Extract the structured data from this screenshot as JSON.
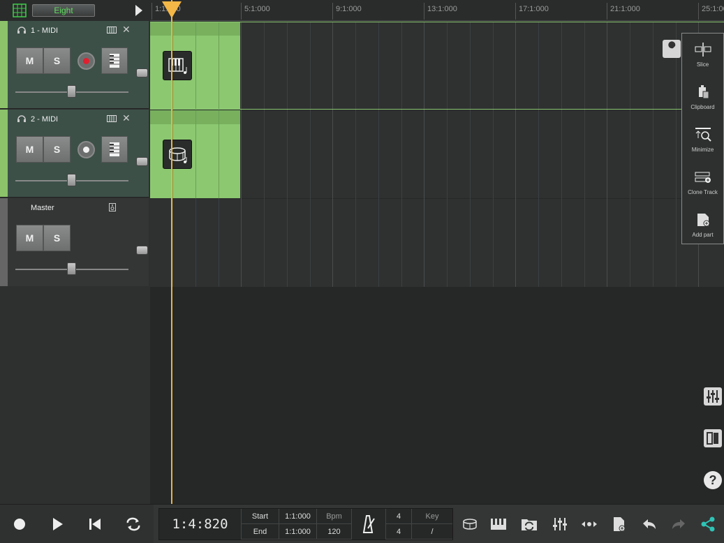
{
  "header": {
    "snap_value": "Eight"
  },
  "ruler": {
    "marks": [
      "1:1:000",
      "5:1:000",
      "9:1:000",
      "13:1:000",
      "17:1:000",
      "21:1:000",
      "25:1:000"
    ]
  },
  "tracks": [
    {
      "name": "1 - MIDI",
      "mute": "M",
      "solo": "S",
      "record_armed": true,
      "volume": 0.5
    },
    {
      "name": "2 - MIDI",
      "mute": "M",
      "solo": "S",
      "record_armed": false,
      "volume": 0.5
    }
  ],
  "master": {
    "name": "Master",
    "mute": "M",
    "solo": "S",
    "volume": 0.5
  },
  "tools": {
    "slice": "Slice",
    "clipboard": "Clipboard",
    "minimize": "Minimize",
    "clone_track": "Clone Track",
    "add_part": "Add part"
  },
  "transport": {
    "position": "1:4:820",
    "start_label": "Start",
    "start_value": "1:1:000",
    "end_label": "End",
    "end_value": "1:1:000",
    "bpm_label": "Bpm",
    "bpm_value": "120",
    "time_sig_top": "4",
    "time_sig_bottom": "4",
    "key_label": "Key",
    "key_value": "/"
  },
  "colors": {
    "accent_green": "#8cc870",
    "playhead": "#f2b746",
    "record": "#e02030",
    "share": "#2ec4b6"
  }
}
